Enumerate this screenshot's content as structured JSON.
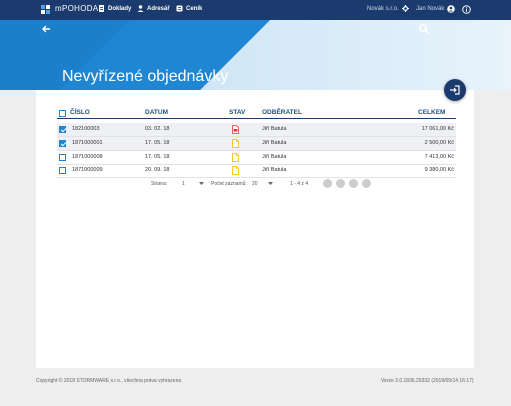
{
  "app": {
    "brand": "mPOHODA",
    "nav": [
      {
        "label": "Doklady",
        "icon": "document-icon"
      },
      {
        "label": "Adresář",
        "icon": "person-icon"
      },
      {
        "label": "Ceník",
        "icon": "pricelist-icon"
      }
    ],
    "company": "Novák s.r.o.",
    "user": "Jan Novák"
  },
  "page": {
    "title": "Nevyřízené objednávky"
  },
  "table": {
    "headers": {
      "number": "ČÍSLO",
      "date": "DATUM",
      "status": "STAV",
      "customer": "ODBĚRATEL",
      "total": "CELKEM"
    },
    "rows": [
      {
        "number": "182100003",
        "date": "03. 02. 18",
        "status": "pdf-red-icon",
        "customer": "Jiří Batula",
        "total": "17 061,00 Kč",
        "checked": true
      },
      {
        "number": "1871000001",
        "date": "17. 05. 18",
        "status": "document-yellow-icon",
        "customer": "Jiří Batula",
        "total": "2 500,00 Kč",
        "checked": true
      },
      {
        "number": "1871000008",
        "date": "17. 05. 18",
        "status": "document-yellow-icon",
        "customer": "Jiří Batula",
        "total": "7 413,00 Kč",
        "checked": false
      },
      {
        "number": "1871000009",
        "date": "20. 09. 18",
        "status": "document-yellow-icon",
        "customer": "Jiří Batula",
        "total": "9 380,00 Kč",
        "checked": false
      }
    ]
  },
  "pager": {
    "page_label": "Strana:",
    "page_value": "1",
    "per_page_label": "Počet záznamů:",
    "per_page_value": "20",
    "range": "1 - 4 z 4"
  },
  "footer": {
    "copyright": "Copyright © 2018 STORMWARE s.r.o., všechna práva vyhrazena",
    "version": "Verze 3.0.1836.29332 (2018/09/14 16:17)"
  },
  "colors": {
    "topbar": "#1b3a6d",
    "hero": "#1e86d2",
    "accent": "#1e86d2",
    "pdf": "#e53935",
    "doc": "#f5b800"
  }
}
